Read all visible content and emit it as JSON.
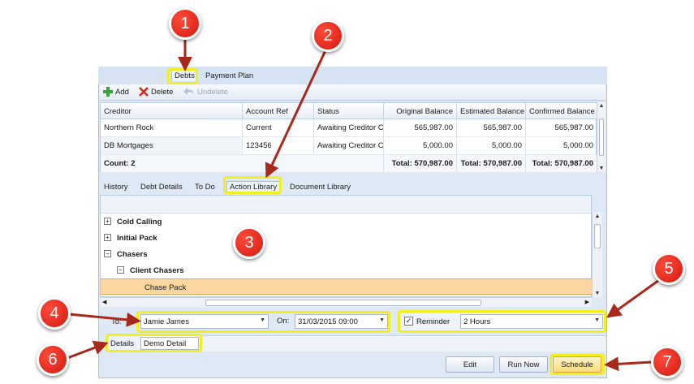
{
  "top_tabs": [
    "Debts",
    "Payment Plan"
  ],
  "toolbar": {
    "add": "Add",
    "delete": "Delete",
    "undelete": "Undelete"
  },
  "debts_grid": {
    "columns": [
      "Creditor",
      "Account Ref",
      "Status",
      "Original Balance",
      "Estimated Balance",
      "Confirmed Balance"
    ],
    "rows": [
      [
        "Northern Rock",
        "Current",
        "Awaiting Creditor C",
        "565,987.00",
        "565,987.00",
        "565,987.00"
      ],
      [
        "DB Mortgages",
        "123456",
        "Awaiting Creditor C",
        "5,000.00",
        "5,000.00",
        "5,000.00"
      ]
    ],
    "footer": {
      "count": "Count: 2",
      "original_total": "Total: 570,987.00",
      "estimated_total": "Total: 570,987.00",
      "confirmed_total": "Total: 570,987.00"
    }
  },
  "detail_tabs": [
    "History",
    "Debt Details",
    "To Do",
    "Action Library",
    "Document Library"
  ],
  "action_library": [
    {
      "label": "Cold Calling",
      "expander": "+"
    },
    {
      "label": "Initial Pack",
      "expander": "+"
    },
    {
      "label": "Chasers",
      "expander": "−"
    },
    {
      "label": "Client Chasers",
      "expander": "−"
    },
    {
      "label": "Chase Pack",
      "expander": ""
    }
  ],
  "schedule_form": {
    "to_label": "To:",
    "to_value": "Jamie James",
    "on_label": "On:",
    "on_value": "31/03/2015 09:00",
    "reminder_label": "Reminder",
    "reminder_checked": "✓",
    "reminder_value": "2 Hours",
    "details_label": "Details",
    "details_value": "Demo Detail"
  },
  "buttons": {
    "edit": "Edit",
    "run_now": "Run Now",
    "schedule": "Schedule"
  },
  "badges": [
    "1",
    "2",
    "3",
    "4",
    "5",
    "6",
    "7"
  ],
  "colors": {
    "highlight": "#f2ef1e",
    "badge": "#e0261a",
    "selected_row": "#fbd6a0"
  }
}
